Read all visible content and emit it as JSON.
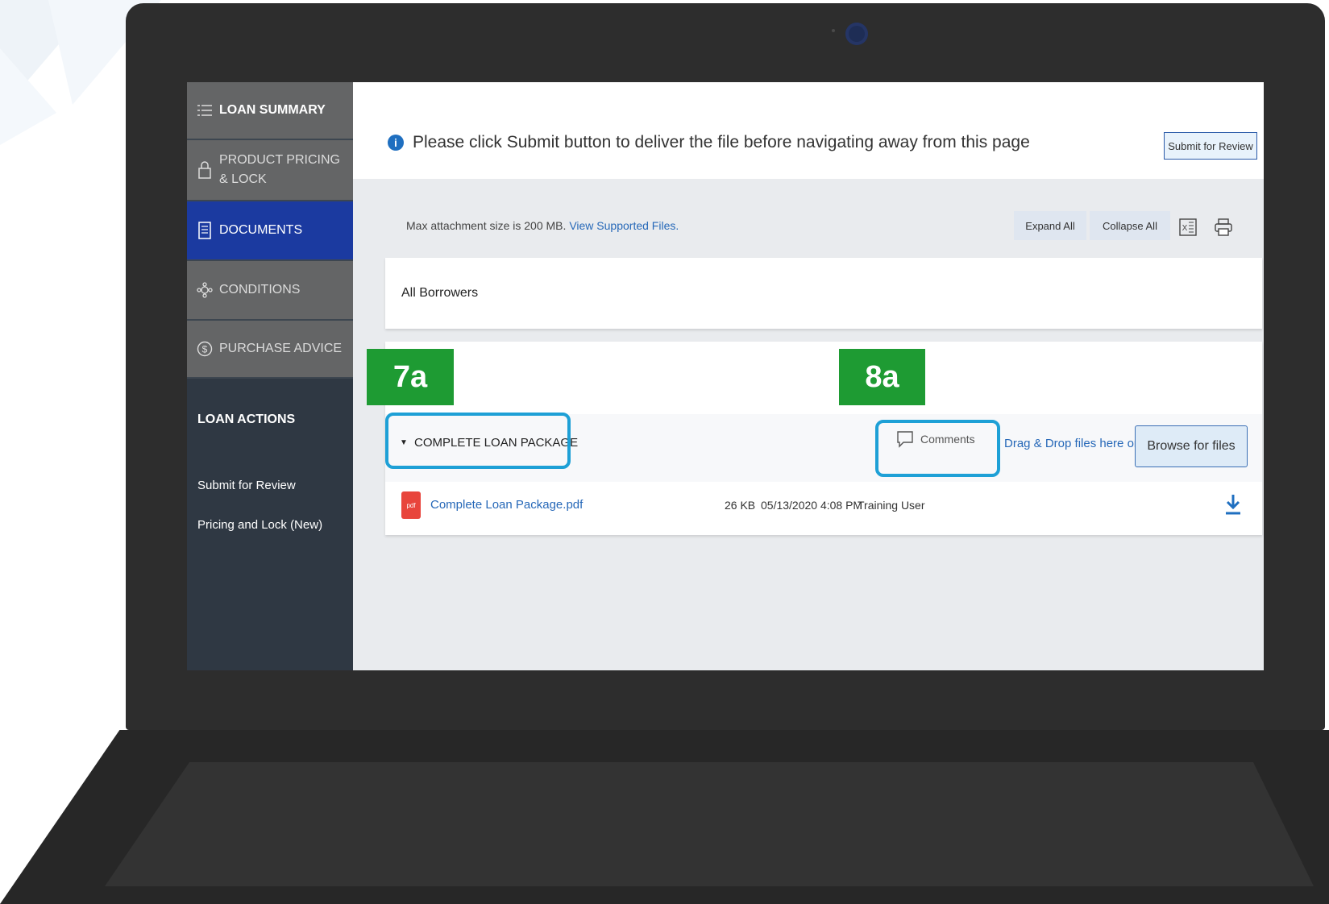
{
  "sidebar": {
    "nav": [
      {
        "label": "LOAN SUMMARY",
        "icon": "list-icon"
      },
      {
        "label": "PRODUCT PRICING & LOCK",
        "icon": "lock-icon"
      },
      {
        "label": "DOCUMENTS",
        "icon": "document-icon"
      },
      {
        "label": "CONDITIONS",
        "icon": "conditions-icon"
      },
      {
        "label": "PURCHASE ADVICE",
        "icon": "dollar-icon"
      }
    ],
    "active": "DOCUMENTS",
    "loan_actions_title": "LOAN ACTIONS",
    "loan_actions": [
      "Submit for Review",
      "Pricing and Lock (New)"
    ]
  },
  "banner": {
    "message": "Please click Submit button to deliver the file before navigating away from this page",
    "icon": "info-icon",
    "submit_label": "Submit for Review"
  },
  "toolbar": {
    "max_text": "Max attachment size is 200 MB.",
    "supported_link": "View Supported Files.",
    "expand_label": "Expand All",
    "collapse_label": "Collapse All",
    "icons": [
      "excel-icon",
      "print-icon"
    ]
  },
  "borrowers_label": "All Borrowers",
  "document_group": {
    "title": "COMPLETE LOAN PACKAGE",
    "comments_label": "Comments",
    "dragdrop_text": "Drag & Drop files here or",
    "browse_label": "Browse for files",
    "files": [
      {
        "name": "Complete Loan Package.pdf",
        "size": "26 KB",
        "date": "05/13/2020 4:08 PM",
        "user": "Training User",
        "type_label": "pdf"
      }
    ]
  },
  "callouts": [
    {
      "label": "7a"
    },
    {
      "label": "8a"
    }
  ],
  "colors": {
    "accent_blue": "#1b3aa0",
    "callout_green": "#1e9b33",
    "callout_border": "#1ea0d6",
    "link_blue": "#2668b8"
  }
}
